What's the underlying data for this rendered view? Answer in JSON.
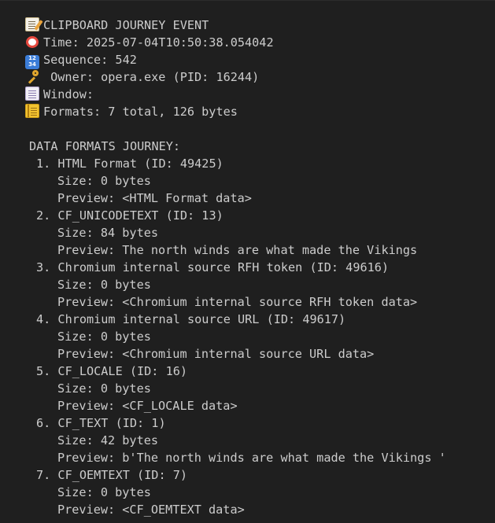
{
  "header": {
    "title": "CLIPBOARD JOURNEY EVENT",
    "time": "Time: 2025-07-04T10:50:38.054042",
    "sequence": "Sequence: 542",
    "owner": " Owner: opera.exe (PID: 16244)",
    "window": "Window:",
    "formats": "Formats: 7 total, 126 bytes"
  },
  "icons": {
    "title": "memo-icon",
    "time": "alarm-clock-icon",
    "sequence": "numbers-icon",
    "owner": "key-icon",
    "window": "page-icon",
    "formats": "ledger-icon"
  },
  "section_title": "DATA FORMATS JOURNEY:",
  "formats": [
    {
      "head": "1. HTML Format (ID: 49425)",
      "size": "Size: 0 bytes",
      "preview": "Preview: <HTML Format data>"
    },
    {
      "head": "2. CF_UNICODETEXT (ID: 13)",
      "size": "Size: 84 bytes",
      "preview": "Preview: The north winds are what made the Vikings"
    },
    {
      "head": "3. Chromium internal source RFH token (ID: 49616)",
      "size": "Size: 0 bytes",
      "preview": "Preview: <Chromium internal source RFH token data>"
    },
    {
      "head": "4. Chromium internal source URL (ID: 49617)",
      "size": "Size: 0 bytes",
      "preview": "Preview: <Chromium internal source URL data>"
    },
    {
      "head": "5. CF_LOCALE (ID: 16)",
      "size": "Size: 0 bytes",
      "preview": "Preview: <CF_LOCALE data>"
    },
    {
      "head": "6. CF_TEXT (ID: 1)",
      "size": "Size: 42 bytes",
      "preview": "Preview: b'The north winds are what made the Vikings '"
    },
    {
      "head": "7. CF_OEMTEXT (ID: 7)",
      "size": "Size: 0 bytes",
      "preview": "Preview: <CF_OEMTEXT data>"
    }
  ]
}
